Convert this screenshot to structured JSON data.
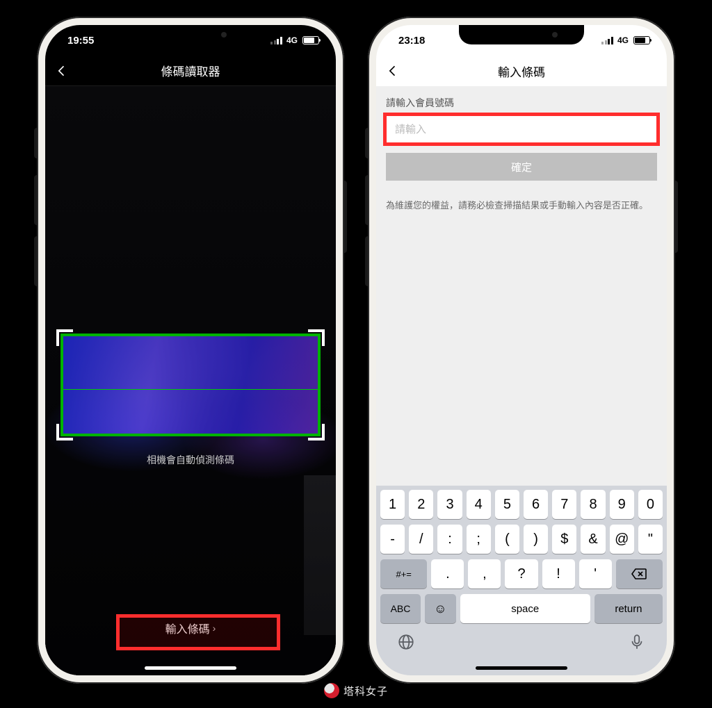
{
  "left": {
    "status": {
      "time": "19:55",
      "network": "4G"
    },
    "nav": {
      "title": "條碼讀取器"
    },
    "scan_hint": "相機會自動偵測條碼",
    "enter_code_label": "輸入條碼"
  },
  "right": {
    "status": {
      "time": "23:18",
      "network": "4G"
    },
    "nav": {
      "title": "輸入條碼"
    },
    "field_label": "請輸入會員號碼",
    "input_placeholder": "請輸入",
    "confirm_label": "確定",
    "notice": "為維護您的權益，請務必檢查掃描結果或手動輸入內容是否正確。",
    "keyboard": {
      "row1": [
        "1",
        "2",
        "3",
        "4",
        "5",
        "6",
        "7",
        "8",
        "9",
        "0"
      ],
      "row2": [
        "-",
        "/",
        ":",
        ";",
        "(",
        ")",
        "$",
        "&",
        "@",
        "\""
      ],
      "row3_shift": "#+=",
      "row3": [
        ".",
        ",",
        "?",
        "!",
        "'"
      ],
      "abc": "ABC",
      "space": "space",
      "return": "return"
    }
  },
  "watermark": "塔科女子"
}
